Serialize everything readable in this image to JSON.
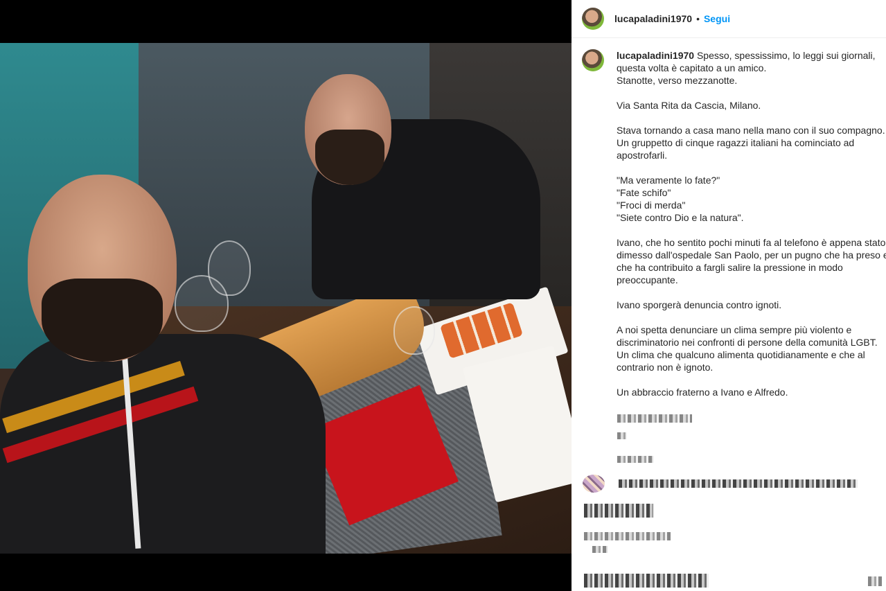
{
  "post": {
    "username": "lucapaladini1970",
    "separator": "•",
    "follow_label": "Segui"
  },
  "caption": {
    "username": "lucapaladini1970",
    "paragraphs": [
      [
        "Spesso, spessissimo, lo leggi sui giornali,",
        "questa volta è capitato a un amico.",
        "Stanotte, verso mezzanotte."
      ],
      [
        "Via Santa Rita da Cascia, Milano."
      ],
      [
        "Stava tornando a casa mano nella mano con il suo compagno.",
        "Un gruppetto di cinque ragazzi italiani ha cominciato ad",
        "apostrofarli."
      ],
      [
        "\"Ma veramente lo fate?\"",
        "\"Fate schifo\"",
        "\"Froci di merda\"",
        "\"Siete contro Dio e la natura\"."
      ],
      [
        "Ivano, che ho sentito pochi minuti fa al telefono è appena stato",
        "dimesso dall'ospedale San Paolo, per un pugno che ha preso e",
        "che ha contribuito a fargli salire la pressione in modo",
        "preoccupante."
      ],
      [
        "Ivano sporgerà denuncia contro ignoti."
      ],
      [
        "A noi spetta denunciare un clima sempre più violento e",
        "discriminatorio nei confronti di persone della comunità LGBT.",
        "Un clima che qualcuno alimenta quotidianamente e che al",
        "contrario non è ignoto."
      ],
      [
        "Un abbraccio fraterno a Ivano e Alfredo."
      ]
    ]
  }
}
